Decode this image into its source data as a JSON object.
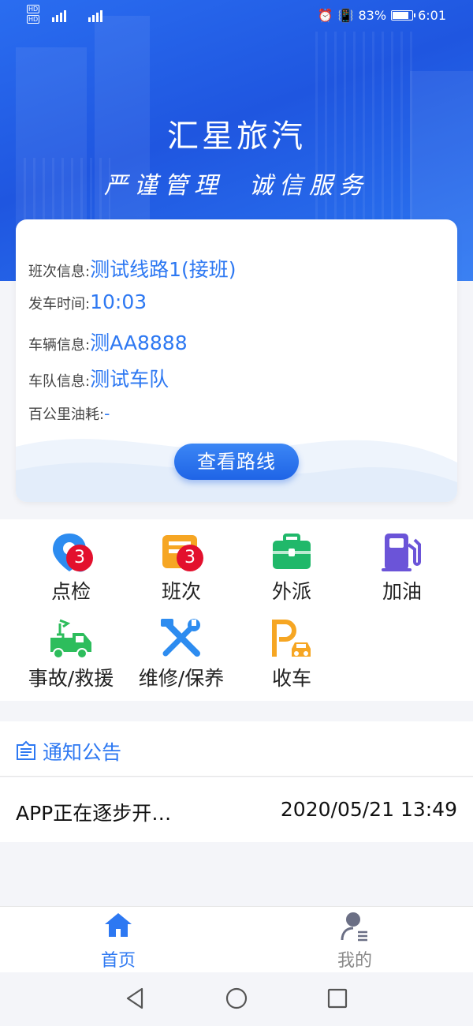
{
  "status_bar": {
    "left_tags": [
      "HD",
      "HD"
    ],
    "network": [
      "4G⁺",
      "4G"
    ],
    "battery": "83%",
    "time": "6:01"
  },
  "header": {
    "app_name": "汇星旅汽",
    "slogan_left": "严谨管理",
    "slogan_right": "诚信服务"
  },
  "info_card": {
    "rows": [
      {
        "label": "班次信息:",
        "value": "测试线路1(接班)"
      },
      {
        "label": "发车时间:",
        "value": "10:03"
      },
      {
        "label": "车辆信息:",
        "value": "测AA8888"
      },
      {
        "label": "车队信息:",
        "value": "测试车队"
      },
      {
        "label": "百公里油耗:",
        "value": "-"
      }
    ],
    "route_button": "查看路线"
  },
  "functions": [
    {
      "label": "点检",
      "icon": "location-check-icon",
      "badge": "3",
      "color": "#2d8cf0"
    },
    {
      "label": "班次",
      "icon": "schedule-clock-icon",
      "badge": "3",
      "color": "#f6a623"
    },
    {
      "label": "外派",
      "icon": "briefcase-icon",
      "badge": "",
      "color": "#20b86a"
    },
    {
      "label": "加油",
      "icon": "fuel-pump-icon",
      "badge": "",
      "color": "#6b54d8"
    },
    {
      "label": "事故/救援",
      "icon": "tow-truck-icon",
      "badge": "",
      "color": "#2dbd5c"
    },
    {
      "label": "维修/保养",
      "icon": "wrench-tools-icon",
      "badge": "",
      "color": "#2d8cf0"
    },
    {
      "label": "收车",
      "icon": "parking-car-icon",
      "badge": "",
      "color": "#f6a623"
    }
  ],
  "notice": {
    "section_title": "通知公告",
    "items": [
      {
        "title": "APP正在逐步开…",
        "date": "2020/05/21 13:49"
      }
    ]
  },
  "tabbar": {
    "tabs": [
      {
        "label": "首页",
        "icon": "home-icon",
        "active": true
      },
      {
        "label": "我的",
        "icon": "user-profile-icon",
        "active": false
      }
    ]
  },
  "system_nav": [
    "back-icon",
    "home-circle-icon",
    "recents-icon"
  ]
}
